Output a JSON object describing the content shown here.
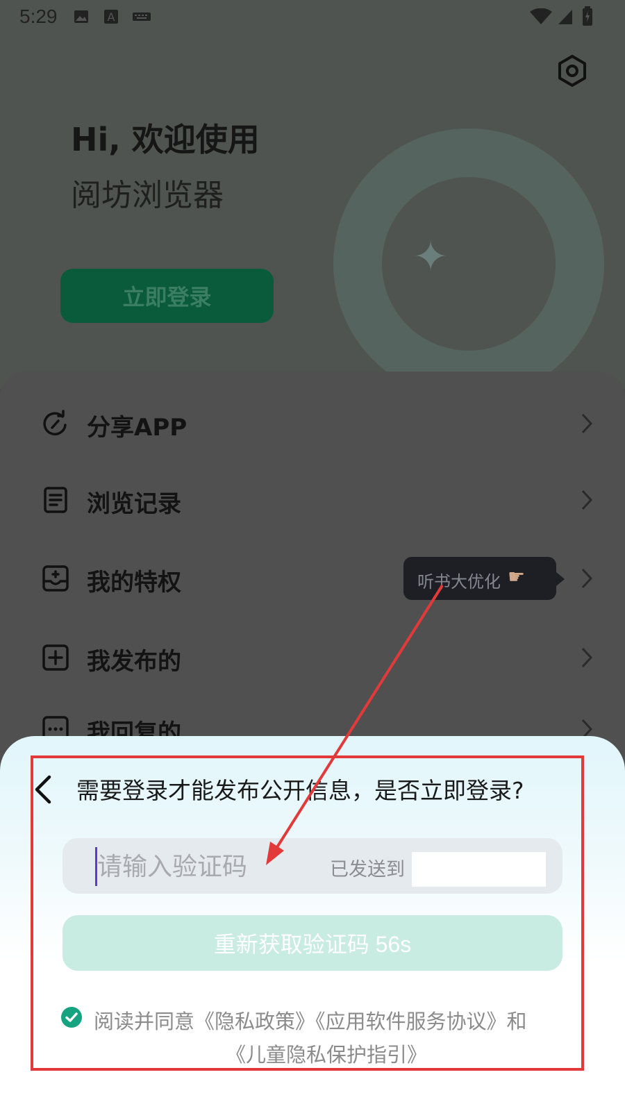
{
  "status_bar": {
    "time": "5:29"
  },
  "header": {
    "greeting": "Hi, 欢迎使用",
    "app_name": "阅坊浏览器",
    "login_button": "立即登录"
  },
  "menu": {
    "items": [
      {
        "label": "分享APP",
        "icon": "share-refresh-icon"
      },
      {
        "label": "浏览记录",
        "icon": "document-icon"
      },
      {
        "label": "我的特权",
        "icon": "privilege-box-icon"
      },
      {
        "label": "我发布的",
        "icon": "plus-square-icon"
      },
      {
        "label": "我回复的",
        "icon": "chat-icon"
      }
    ],
    "tooltip": "听书大优化"
  },
  "sheet": {
    "question": "需要登录才能发布公开信息，是否立即登录?",
    "code_placeholder": "请输入验证码",
    "sent_to_label": "已发送到",
    "resend_label": "重新获取验证码 56s",
    "agreement_line1": "阅读并同意《隐私政策》《应用软件服务协议》和",
    "agreement_line2": "《儿童隐私保护指引》"
  },
  "colors": {
    "accent_green": "#0a5a3c",
    "check_green": "#16a37f",
    "annotation_red": "#e23a3a"
  }
}
